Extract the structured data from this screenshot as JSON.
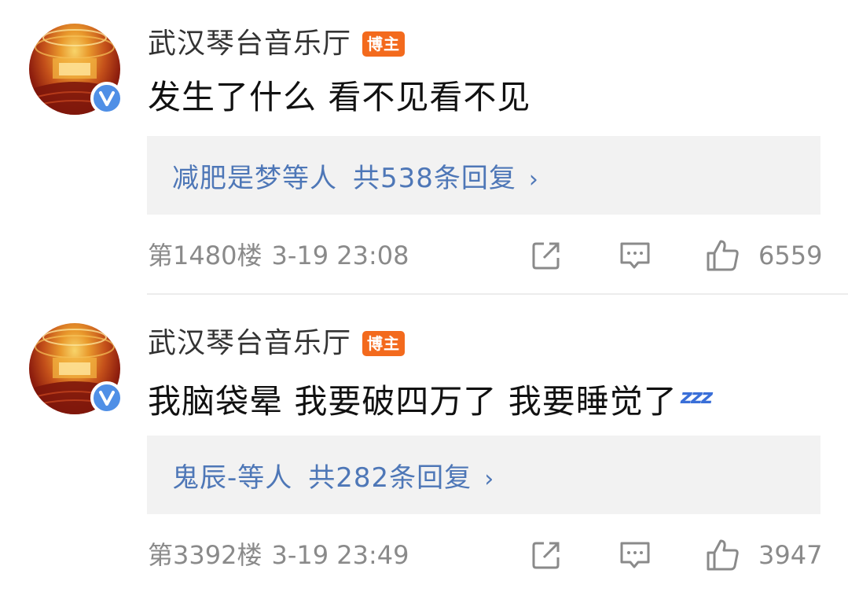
{
  "comments": [
    {
      "user": "武汉琴台音乐厅",
      "badge": "博主",
      "text": "发生了什么 看不见看不见",
      "emoji": "",
      "replies_users": "减肥是梦等人",
      "replies_count": "共538条回复",
      "floor": "第1480楼",
      "time": "3-19 23:08",
      "likes": "6559"
    },
    {
      "user": "武汉琴台音乐厅",
      "badge": "博主",
      "text": "我脑袋晕 我要破四万了 我要睡觉了",
      "emoji": "zzz",
      "replies_users": "鬼辰-等人",
      "replies_count": "共282条回复",
      "floor": "第3392楼",
      "time": "3-19 23:49",
      "likes": "3947"
    }
  ],
  "icons": {
    "avatar": "concert-hall-avatar",
    "verified": "verified-v-icon",
    "chevron": "chevron-right-icon",
    "share": "share-icon",
    "comment": "comment-icon",
    "like": "thumbs-up-icon"
  },
  "colors": {
    "badge": "#f36a1d",
    "verified": "#4f8fe6",
    "link": "#4e77b7",
    "meta": "#8a8a8a",
    "reply_bg": "#f2f2f2"
  }
}
